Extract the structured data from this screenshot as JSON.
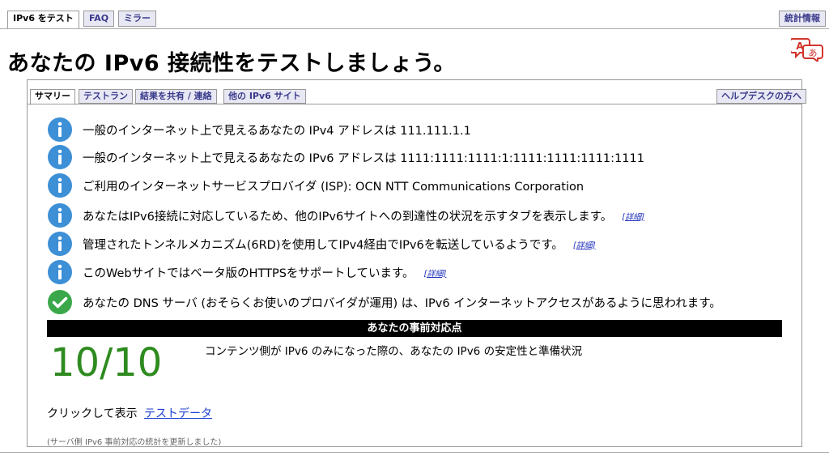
{
  "nav": {
    "tabs": [
      "IPv6 をテスト",
      "FAQ",
      "ミラー"
    ],
    "stats_label": "統計情報"
  },
  "page_title": "あなたの IPv6 接続性をテストしましょう。",
  "translate_glyphs": {
    "a": "A",
    "b": "あ"
  },
  "subtabs": [
    "サマリー",
    "テストラン",
    "結果を共有 / 連絡",
    "他の IPv6 サイト"
  ],
  "helpdesk_label": "ヘルプデスクの方へ",
  "results": [
    {
      "icon": "info-icon",
      "text": "一般のインターネット上で見えるあなたの IPv4 アドレスは 111.111.1.1",
      "more": ""
    },
    {
      "icon": "info-icon",
      "text": "一般のインターネット上で見えるあなたの IPv6 アドレスは 1111:1111:1111:1:1111:1111:1111:1111",
      "more": ""
    },
    {
      "icon": "info-icon",
      "text": "ご利用のインターネットサービスプロバイダ (ISP): OCN NTT Communications Corporation",
      "more": ""
    },
    {
      "icon": "info-icon",
      "text": "あなたはIPv6接続に対応しているため、他のIPv6サイトへの到達性の状況を示すタブを表示します。",
      "more": "[詳細]"
    },
    {
      "icon": "info-icon",
      "text": "管理されたトンネルメカニズム(6RD)を使用してIPv4経由でIPv6を転送しているようです。",
      "more": "[詳細]"
    },
    {
      "icon": "info-icon",
      "text": "このWebサイトではベータ版のHTTPSをサポートしています。",
      "more": "[詳細]"
    },
    {
      "icon": "check-icon",
      "text": "あなたの DNS サーバ (おそらくお使いのプロバイダが運用) は、IPv6 インターネットアクセスがあるように思われます。",
      "more": ""
    }
  ],
  "score": {
    "header": "あなたの事前対応点",
    "value": "10/10",
    "description": "コンテンツ側が IPv6 のみになった際の、あなたの IPv6 の安定性と準備状況"
  },
  "click_label": "クリックして表示",
  "test_data_link": "テストデータ",
  "note": "(サーバ側 IPv6 事前対応の統計を更新しました)",
  "colors": {
    "info": "#3d8fd6",
    "check": "#3aa84a",
    "score": "#2e8b1f",
    "link": "#1a3fcf"
  }
}
